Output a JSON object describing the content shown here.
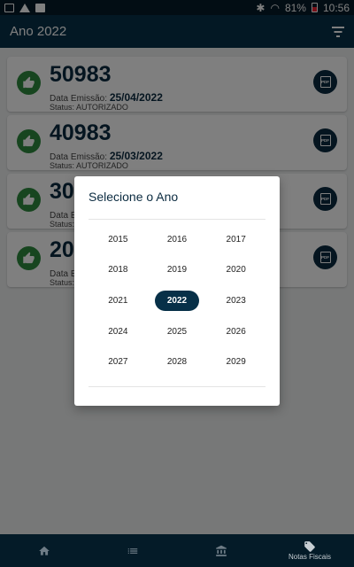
{
  "status_bar": {
    "battery": "81%",
    "time": "10:56"
  },
  "app_bar": {
    "title": "Ano 2022",
    "filter_icon": "filter-icon"
  },
  "cards": [
    {
      "number": "50983",
      "date_label": "Data Emissão:",
      "date": "25/04/2022",
      "status_label": "Status:",
      "status": "AUTORIZADO"
    },
    {
      "number": "40983",
      "date_label": "Data Emissão:",
      "date": "25/03/2022",
      "status_label": "Status:",
      "status": "AUTORIZADO"
    },
    {
      "number": "30983",
      "date_label": "Data Emissão:",
      "date": "",
      "status_label": "Status:",
      "status": ""
    },
    {
      "number": "20983",
      "date_label": "Data Emissão:",
      "date": "",
      "status_label": "Status:",
      "status": ""
    }
  ],
  "dialog": {
    "title": "Selecione o Ano",
    "selected": "2022",
    "years": [
      "2015",
      "2016",
      "2017",
      "2018",
      "2019",
      "2020",
      "2021",
      "2022",
      "2023",
      "2024",
      "2025",
      "2026",
      "2027",
      "2028",
      "2029"
    ]
  },
  "bottom_nav": {
    "items": [
      {
        "icon": "home-icon",
        "label": ""
      },
      {
        "icon": "list-icon",
        "label": ""
      },
      {
        "icon": "money-icon",
        "label": ""
      },
      {
        "icon": "tag-icon",
        "label": "Notas Fiscais"
      }
    ],
    "active": "Notas Fiscais"
  },
  "colors": {
    "primary": "#073048",
    "status_bar": "#041b28",
    "success": "#2e8b3f"
  }
}
